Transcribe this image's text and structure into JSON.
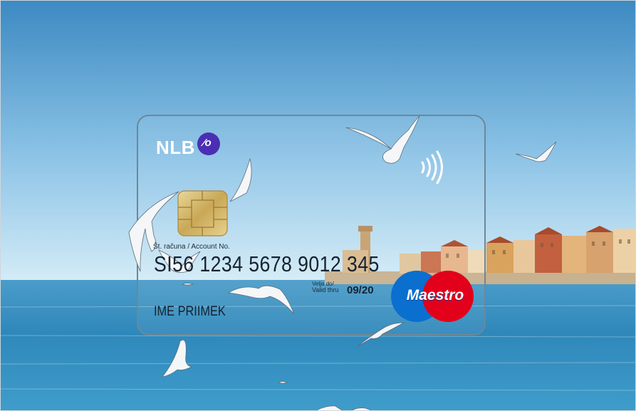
{
  "card": {
    "bank_name": "NLB",
    "bank_badge": "⁄o",
    "account_label": "Št. računa / Account No.",
    "account_number": "SI56 1234 5678 9012 345",
    "valid_label_line1": "Velja do/",
    "valid_label_line2": "Valid thru",
    "valid_date": "09/20",
    "holder_name": "IME PRIIMEK",
    "brand": "Maestro"
  },
  "colors": {
    "sky_top": "#3f8fc6",
    "sky_bottom": "#bfe0f2",
    "sea": "#2b86b8",
    "badge": "#4b2fb3",
    "maestro_red": "#e3001b",
    "maestro_blue": "#0a6fcf"
  },
  "icons": [
    "contactless-icon",
    "chip-icon",
    "maestro-logo",
    "seagull-icon"
  ]
}
